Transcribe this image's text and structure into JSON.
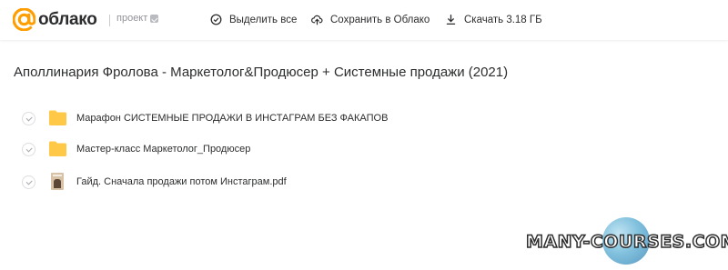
{
  "header": {
    "logo_text": "облако",
    "project_label": "проект",
    "select_all_label": "Выделить все",
    "save_label": "Сохранить в Облако",
    "download_label": "Скачать 3.18 ГБ"
  },
  "folder_title": "Аполлинария Фролова - Маркетолог&Продюсер + Системные продажи (2021)",
  "items": [
    {
      "name": "Марафон СИСТЕМНЫЕ ПРОДАЖИ В ИНСТАГРАМ БЕЗ ФАКАПОВ",
      "type": "folder",
      "icon": "folder-icon"
    },
    {
      "name": "Мастер-класс Маркетолог_Продюсер",
      "type": "folder",
      "icon": "folder-icon"
    },
    {
      "name": "Гайд. Сначала продажи потом Инстаграм.pdf",
      "type": "pdf",
      "icon": "pdf-thumbnail"
    }
  ],
  "watermark": {
    "text": "MANY-COURSES.COM"
  },
  "colors": {
    "accent": "#ff9e00",
    "folder": "#ffc947",
    "text": "#2c2d2e",
    "muted": "#919399"
  }
}
